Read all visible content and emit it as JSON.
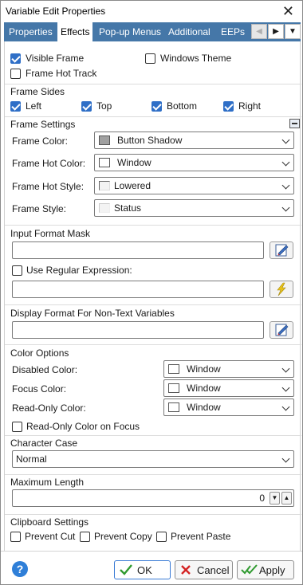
{
  "window": {
    "title": "Variable Edit Properties"
  },
  "tabs": [
    "Properties",
    "Effects",
    "Pop-up Menus",
    "Additional",
    "EEPs"
  ],
  "active_tab": "Effects",
  "top_options": {
    "visible_frame": {
      "label": "Visible Frame",
      "checked": true
    },
    "windows_theme": {
      "label": "Windows Theme",
      "checked": false
    },
    "frame_hot_track": {
      "label": "Frame Hot Track",
      "checked": false
    }
  },
  "frame_sides": {
    "title": "Frame Sides",
    "left": {
      "label": "Left",
      "checked": true
    },
    "top": {
      "label": "Top",
      "checked": true
    },
    "bottom": {
      "label": "Bottom",
      "checked": true
    },
    "right": {
      "label": "Right",
      "checked": true
    }
  },
  "frame_settings": {
    "title": "Frame Settings",
    "frame_color": {
      "label": "Frame Color:",
      "value": "Button Shadow",
      "swatch": "#a0a0a0"
    },
    "frame_hot_color": {
      "label": "Frame Hot Color:",
      "value": "Window",
      "swatch": "#ffffff"
    },
    "frame_hot_style": {
      "label": "Frame Hot Style:",
      "value": "Lowered"
    },
    "frame_style": {
      "label": "Frame Style:",
      "value": "Status"
    }
  },
  "input_format_mask": {
    "title": "Input Format Mask",
    "value": "",
    "use_regex": {
      "label": "Use Regular Expression:",
      "checked": false
    },
    "regex_value": ""
  },
  "display_format": {
    "title": "Display Format For Non-Text Variables",
    "value": ""
  },
  "color_options": {
    "title": "Color Options",
    "disabled_color": {
      "label": "Disabled Color:",
      "value": "Window"
    },
    "focus_color": {
      "label": "Focus Color:",
      "value": "Window"
    },
    "readonly_color": {
      "label": "Read-Only Color:",
      "value": "Window"
    },
    "readonly_on_focus": {
      "label": "Read-Only Color on Focus",
      "checked": false
    }
  },
  "character_case": {
    "title": "Character Case",
    "value": "Normal"
  },
  "maximum_length": {
    "title": "Maximum Length",
    "value": "0"
  },
  "clipboard": {
    "title": "Clipboard Settings",
    "prevent_cut": {
      "label": "Prevent Cut",
      "checked": false
    },
    "prevent_copy": {
      "label": "Prevent Copy",
      "checked": false
    },
    "prevent_paste": {
      "label": "Prevent Paste",
      "checked": false
    }
  },
  "buttons": {
    "ok": "OK",
    "cancel": "Cancel",
    "apply": "Apply",
    "help": "?"
  },
  "colors": {
    "tabbar": "#4577a8",
    "accent": "#2f6fc7"
  }
}
